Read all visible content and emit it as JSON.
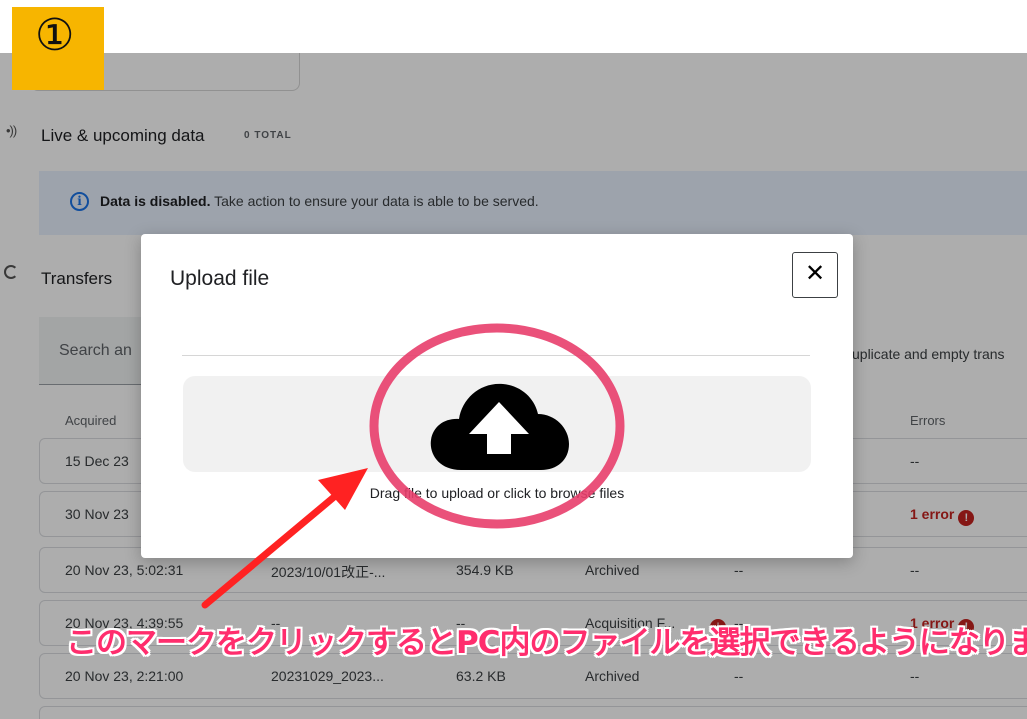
{
  "step_badge": "①",
  "live_section": {
    "title": "Live & upcoming data",
    "count": "0 TOTAL"
  },
  "banner": {
    "bold": "Data is disabled.",
    "text": " Take action to ensure your data is able to be served."
  },
  "transfers": {
    "title": "Transfers",
    "search_placeholder": "Search an",
    "toggle_text": "uplicate and empty trans",
    "columns": {
      "acquired": "Acquired",
      "errors": "Errors"
    },
    "rows": [
      {
        "acquired": "15 Dec 23",
        "file": "",
        "size": "",
        "status": "",
        "errors": "--"
      },
      {
        "acquired": "30 Nov 23",
        "file": "",
        "size": "",
        "status": "",
        "errors": "1 error"
      },
      {
        "acquired": "20 Nov 23, 5:02:31",
        "file": "2023/10/01改正-...",
        "size": "354.9 KB",
        "status": "Archived",
        "dash": "--",
        "errors": "--"
      },
      {
        "acquired": "20 Nov 23, 4:39:55",
        "file": "--",
        "size": "--",
        "status": "Acquisition F...",
        "dash": "--",
        "errors": "1 error"
      },
      {
        "acquired": "20 Nov 23, 2:21:00",
        "file": "20231029_2023...",
        "size": "63.2 KB",
        "status": "Archived",
        "dash": "--",
        "errors": "--"
      }
    ]
  },
  "modal": {
    "title": "Upload file",
    "close_label": "✕",
    "drop_text": "Drag file to upload or click to browse files"
  },
  "annotation": {
    "text": "このマークをクリックするとPC内のファイルを選択できるようになります",
    "color": "#ff2d6d"
  },
  "colors": {
    "badge": "#f7b500",
    "error": "#c5221f",
    "banner_bg": "#e8f0fe"
  }
}
